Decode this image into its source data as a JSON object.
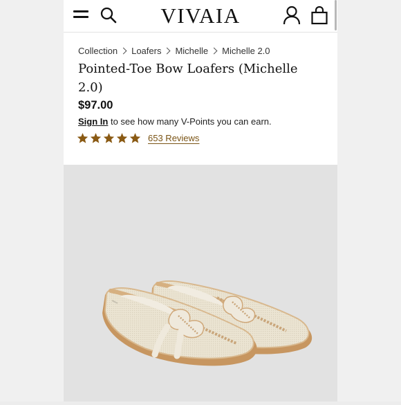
{
  "header": {
    "logo_text": "VIVAIA",
    "icons": [
      "menu-icon",
      "search-icon",
      "account-icon",
      "shopping-bag-icon"
    ]
  },
  "breadcrumb": {
    "items": [
      "Collection",
      "Loafers",
      "Michelle",
      "Michelle 2.0"
    ]
  },
  "product": {
    "title": "Pointed-Toe Bow Loafers (Michelle 2.0)",
    "price": "$97.00",
    "signin_link": "Sign In",
    "signin_text": " to see how many V-Points you can earn.",
    "rating_stars": 5,
    "rating_max": 5,
    "reviews": "653 Reviews"
  },
  "colors": {
    "star": "#8a5a14",
    "reviews_link": "#7a5415",
    "shoe_body": "#ece6d6",
    "shoe_trim": "#d8b88e",
    "sole": "#c79660",
    "image_background": "#e2e2e2"
  }
}
